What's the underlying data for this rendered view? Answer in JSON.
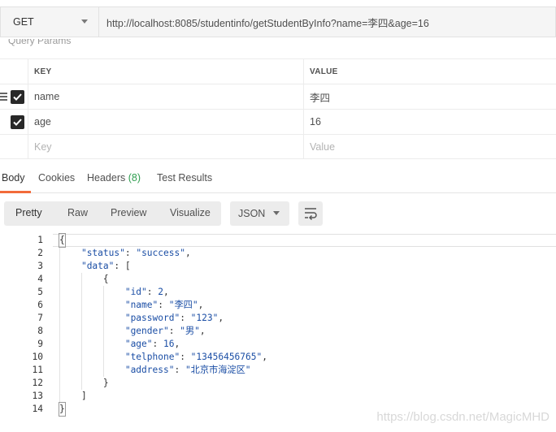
{
  "request": {
    "method": "GET",
    "url": "http://localhost:8085/studentinfo/getStudentByInfo?name=李四&age=16"
  },
  "query_params": {
    "title": "Query Params",
    "header_key": "KEY",
    "header_value": "VALUE",
    "rows": [
      {
        "key": "name",
        "value": "李四",
        "checked": true
      },
      {
        "key": "age",
        "value": "16",
        "checked": true
      }
    ],
    "placeholder_key": "Key",
    "placeholder_value": "Value"
  },
  "response_tabs": {
    "body": "Body",
    "cookies": "Cookies",
    "headers": "Headers",
    "headers_count": "(8)",
    "test_results": "Test Results"
  },
  "format_bar": {
    "pretty": "Pretty",
    "raw": "Raw",
    "preview": "Preview",
    "visualize": "Visualize",
    "format": "JSON"
  },
  "code": {
    "line_numbers": [
      "1",
      "2",
      "3",
      "4",
      "5",
      "6",
      "7",
      "8",
      "9",
      "10",
      "11",
      "12",
      "13",
      "14"
    ],
    "status_key": "\"status\"",
    "status_val": "\"success\"",
    "data_key": "\"data\"",
    "id_key": "\"id\"",
    "id_val": "2",
    "name_key": "\"name\"",
    "name_val": "\"李四\"",
    "password_key": "\"password\"",
    "password_val": "\"123\"",
    "gender_key": "\"gender\"",
    "gender_val": "\"男\"",
    "age_key": "\"age\"",
    "age_val": "16",
    "telphone_key": "\"telphone\"",
    "telphone_val": "\"13456456765\"",
    "address_key": "\"address\"",
    "address_val": "\"北京市海淀区\""
  },
  "watermark": "https://blog.csdn.net/MagicMHD"
}
